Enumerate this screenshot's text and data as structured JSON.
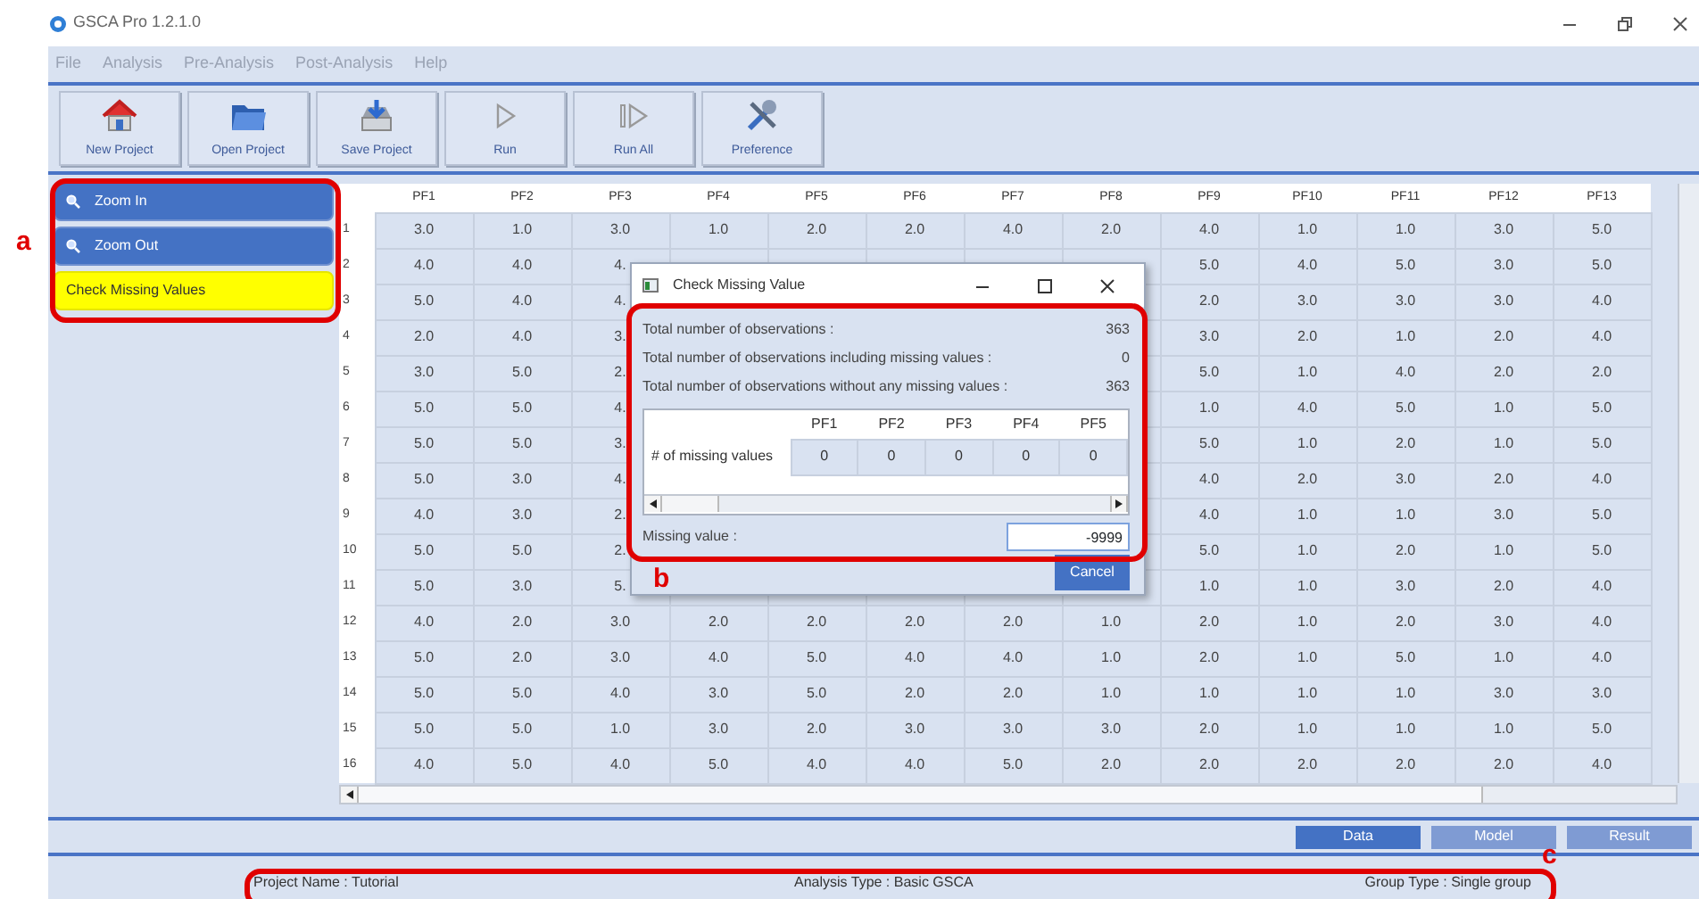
{
  "window": {
    "title": "GSCA Pro 1.2.1.0"
  },
  "menu": [
    "File",
    "Analysis",
    "Pre-Analysis",
    "Post-Analysis",
    "Help"
  ],
  "toolbar": [
    {
      "label": "New Project",
      "kind": "home"
    },
    {
      "label": "Open Project",
      "kind": "folder"
    },
    {
      "label": "Save Project",
      "kind": "save"
    },
    {
      "label": "Run",
      "kind": "run"
    },
    {
      "label": "Run All",
      "kind": "run-all"
    },
    {
      "label": "Preference",
      "kind": "tools"
    }
  ],
  "sidebar": {
    "items": [
      {
        "label": "Zoom In",
        "kind": "zoom",
        "selected": false
      },
      {
        "label": "Zoom Out",
        "kind": "zoom",
        "selected": false
      },
      {
        "label": "Check Missing Values",
        "kind": "plain",
        "selected": true
      }
    ]
  },
  "table": {
    "columns": [
      "PF1",
      "PF2",
      "PF3",
      "PF4",
      "PF5",
      "PF6",
      "PF7",
      "PF8",
      "PF9",
      "PF10",
      "PF11",
      "PF12",
      "PF13"
    ],
    "rows": [
      {
        "number": "1",
        "cells": [
          "3.0",
          "1.0",
          "3.0",
          "1.0",
          "2.0",
          "2.0",
          "4.0",
          "2.0",
          "4.0",
          "1.0",
          "1.0",
          "3.0",
          "5.0"
        ]
      },
      {
        "number": "2",
        "cells": [
          "4.0",
          "4.0",
          "4.",
          null,
          null,
          null,
          null,
          null,
          "5.0",
          "4.0",
          "5.0",
          "3.0",
          "5.0"
        ]
      },
      {
        "number": "3",
        "cells": [
          "5.0",
          "4.0",
          "4.",
          null,
          null,
          null,
          null,
          null,
          "2.0",
          "3.0",
          "3.0",
          "3.0",
          "4.0"
        ]
      },
      {
        "number": "4",
        "cells": [
          "2.0",
          "4.0",
          "3.",
          null,
          null,
          null,
          null,
          null,
          "3.0",
          "2.0",
          "1.0",
          "2.0",
          "4.0"
        ]
      },
      {
        "number": "5",
        "cells": [
          "3.0",
          "5.0",
          "2.",
          null,
          null,
          null,
          null,
          null,
          "5.0",
          "1.0",
          "4.0",
          "2.0",
          "2.0"
        ]
      },
      {
        "number": "6",
        "cells": [
          "5.0",
          "5.0",
          "4.",
          null,
          null,
          null,
          null,
          null,
          "1.0",
          "4.0",
          "5.0",
          "1.0",
          "5.0"
        ]
      },
      {
        "number": "7",
        "cells": [
          "5.0",
          "5.0",
          "3.",
          null,
          null,
          null,
          null,
          null,
          "5.0",
          "1.0",
          "2.0",
          "1.0",
          "5.0"
        ]
      },
      {
        "number": "8",
        "cells": [
          "5.0",
          "3.0",
          "4.",
          null,
          null,
          null,
          null,
          null,
          "4.0",
          "2.0",
          "3.0",
          "2.0",
          "4.0"
        ]
      },
      {
        "number": "9",
        "cells": [
          "4.0",
          "3.0",
          "2.",
          null,
          null,
          null,
          null,
          null,
          "4.0",
          "1.0",
          "1.0",
          "3.0",
          "5.0"
        ]
      },
      {
        "number": "10",
        "cells": [
          "5.0",
          "5.0",
          "2.",
          null,
          null,
          null,
          null,
          null,
          "5.0",
          "1.0",
          "2.0",
          "1.0",
          "5.0"
        ]
      },
      {
        "number": "11",
        "cells": [
          "5.0",
          "3.0",
          "5.",
          null,
          null,
          null,
          null,
          null,
          "1.0",
          "1.0",
          "3.0",
          "2.0",
          "4.0"
        ]
      },
      {
        "number": "12",
        "cells": [
          "4.0",
          "2.0",
          "3.0",
          "2.0",
          "2.0",
          "2.0",
          "2.0",
          "1.0",
          "2.0",
          "1.0",
          "2.0",
          "3.0",
          "4.0"
        ]
      },
      {
        "number": "13",
        "cells": [
          "5.0",
          "2.0",
          "3.0",
          "4.0",
          "5.0",
          "4.0",
          "4.0",
          "1.0",
          "2.0",
          "1.0",
          "5.0",
          "1.0",
          "4.0"
        ]
      },
      {
        "number": "14",
        "cells": [
          "5.0",
          "5.0",
          "4.0",
          "3.0",
          "5.0",
          "2.0",
          "2.0",
          "1.0",
          "1.0",
          "1.0",
          "1.0",
          "3.0",
          "3.0"
        ]
      },
      {
        "number": "15",
        "cells": [
          "5.0",
          "5.0",
          "1.0",
          "3.0",
          "2.0",
          "3.0",
          "3.0",
          "3.0",
          "2.0",
          "1.0",
          "1.0",
          "1.0",
          "5.0"
        ]
      },
      {
        "number": "16",
        "cells": [
          "4.0",
          "5.0",
          "4.0",
          "5.0",
          "4.0",
          "4.0",
          "5.0",
          "2.0",
          "2.0",
          "2.0",
          "2.0",
          "2.0",
          "4.0"
        ]
      }
    ]
  },
  "dialog": {
    "title": "Check Missing Value",
    "stats": [
      {
        "label": "Total number of observations :",
        "value": "363"
      },
      {
        "label": "Total number of observations including missing values :",
        "value": "0"
      },
      {
        "label": "Total number of observations without any missing values :",
        "value": "363"
      }
    ],
    "table": {
      "columns": [
        "PF1",
        "PF2",
        "PF3",
        "PF4",
        "PF5"
      ],
      "row_label": "# of missing values",
      "values": [
        "0",
        "0",
        "0",
        "0",
        "0"
      ]
    },
    "missing_value": {
      "label": "Missing value :",
      "value": "-9999"
    },
    "buttons": [
      "Cancel"
    ]
  },
  "view_tabs": [
    {
      "label": "Data",
      "selected": true
    },
    {
      "label": "Model",
      "selected": false
    },
    {
      "label": "Result",
      "selected": false
    }
  ],
  "status_bar": [
    "Project Name : Tutorial",
    "Analysis Type : Basic GSCA",
    "Group Type : Single group"
  ],
  "annotations": [
    {
      "label": "a"
    },
    {
      "label": "b"
    },
    {
      "label": "c"
    }
  ]
}
